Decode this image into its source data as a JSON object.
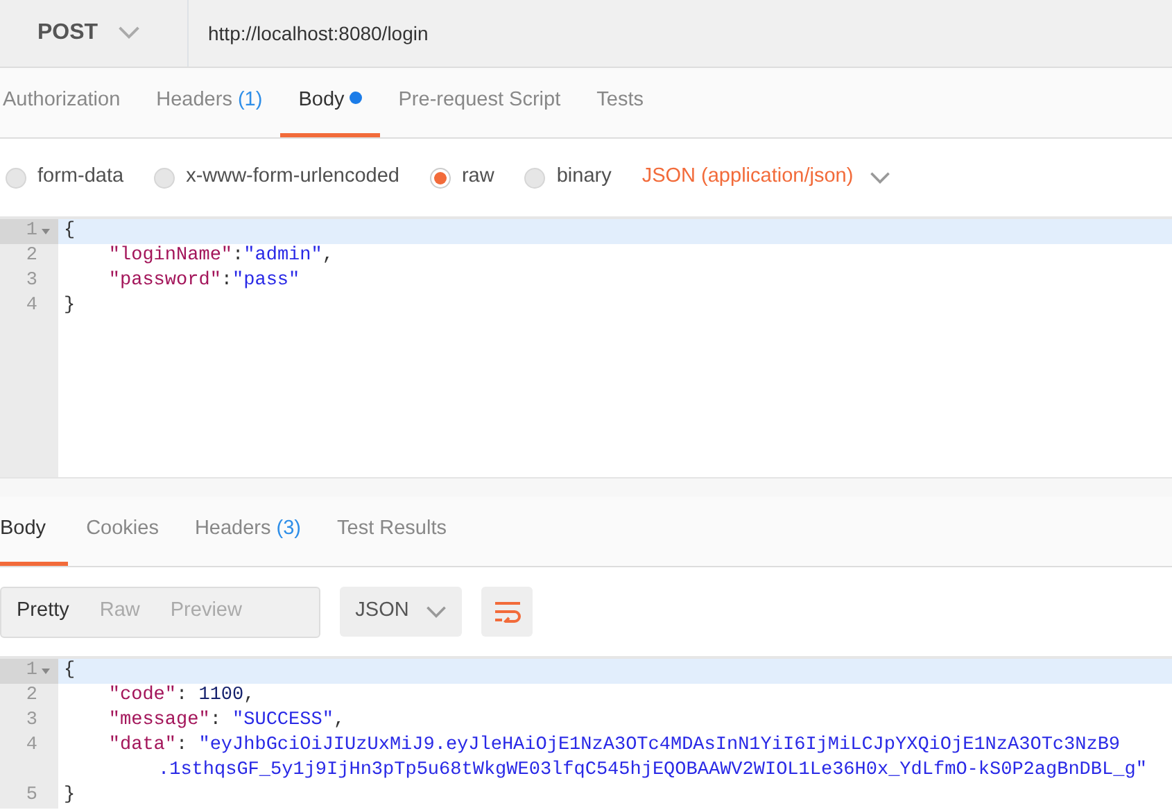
{
  "request": {
    "method": "POST",
    "url": "http://localhost:8080/login"
  },
  "request_tabs": [
    {
      "label": "Authorization",
      "dot": false,
      "selected": false
    },
    {
      "label": "Headers",
      "count": "(1)",
      "dot": false,
      "selected": false
    },
    {
      "label": "Body",
      "dot": true,
      "selected": true
    },
    {
      "label": "Pre-request Script",
      "dot": false,
      "selected": false
    },
    {
      "label": "Tests",
      "dot": false,
      "selected": false
    }
  ],
  "body_types": [
    {
      "label": "form-data",
      "selected": false
    },
    {
      "label": "x-www-form-urlencoded",
      "selected": false
    },
    {
      "label": "raw",
      "selected": true
    },
    {
      "label": "binary",
      "selected": false
    }
  ],
  "content_type": "JSON (application/json)",
  "request_body": [
    {
      "number": "1",
      "foldable": true,
      "active": true,
      "tokens": [
        {
          "kind": "punct",
          "text": "{"
        }
      ]
    },
    {
      "number": "2",
      "foldable": false,
      "active": false,
      "tokens": [
        {
          "kind": "key",
          "text": "    \"loginName\""
        },
        {
          "kind": "punct",
          "text": ":"
        },
        {
          "kind": "string",
          "text": "\"admin\""
        },
        {
          "kind": "punct",
          "text": ","
        }
      ]
    },
    {
      "number": "3",
      "foldable": false,
      "active": false,
      "tokens": [
        {
          "kind": "key",
          "text": "    \"password\""
        },
        {
          "kind": "punct",
          "text": ":"
        },
        {
          "kind": "string",
          "text": "\"pass\""
        }
      ]
    },
    {
      "number": "4",
      "foldable": false,
      "active": false,
      "tokens": [
        {
          "kind": "punct",
          "text": "}"
        }
      ]
    }
  ],
  "response_tabs": [
    {
      "label": "Body",
      "selected": true
    },
    {
      "label": "Cookies",
      "selected": false
    },
    {
      "label": "Headers",
      "count": "(3)",
      "selected": false
    },
    {
      "label": "Test Results",
      "selected": false
    }
  ],
  "view_modes": [
    {
      "label": "Pretty",
      "selected": true
    },
    {
      "label": "Raw",
      "selected": false
    },
    {
      "label": "Preview",
      "selected": false
    }
  ],
  "format": "JSON",
  "response_body": [
    {
      "number": "1",
      "foldable": true,
      "active": true,
      "tokens": [
        {
          "kind": "punct",
          "text": "{"
        }
      ]
    },
    {
      "number": "2",
      "foldable": false,
      "active": false,
      "tokens": [
        {
          "kind": "key",
          "text": "    \"code\""
        },
        {
          "kind": "punct",
          "text": ": "
        },
        {
          "kind": "number",
          "text": "1100"
        },
        {
          "kind": "punct",
          "text": ","
        }
      ]
    },
    {
      "number": "3",
      "foldable": false,
      "active": false,
      "tokens": [
        {
          "kind": "key",
          "text": "    \"message\""
        },
        {
          "kind": "punct",
          "text": ": "
        },
        {
          "kind": "string",
          "text": "\"SUCCESS\""
        },
        {
          "kind": "punct",
          "text": ","
        }
      ]
    },
    {
      "number": "4",
      "foldable": false,
      "active": false,
      "tokens": [
        {
          "kind": "key",
          "text": "    \"data\""
        },
        {
          "kind": "punct",
          "text": ": "
        },
        {
          "kind": "string",
          "text": "\"eyJhbGciOiJIUzUxMiJ9.eyJleHAiOjE1NzA3OTc4MDAsInN1YiI6IjMiLCJpYXQiOjE1NzA3OTc3NzB9"
        }
      ],
      "continuation": [
        {
          "kind": "string",
          "text": ".1sthqsGF_5y1j9IjHn3pTp5u68tWkgWE03lfqC545hjEQOBAAWV2WIOL1Le36H0x_YdLfmO-kS0P2agBnDBL_g\""
        }
      ]
    },
    {
      "number": "5",
      "foldable": false,
      "active": false,
      "tokens": [
        {
          "kind": "punct",
          "text": "}"
        }
      ]
    }
  ]
}
